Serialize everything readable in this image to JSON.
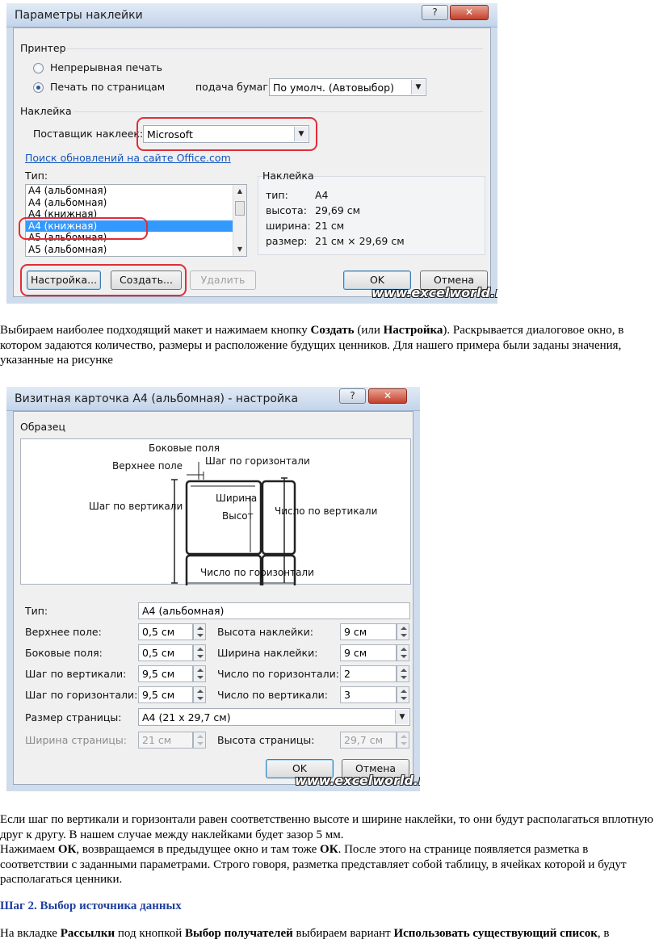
{
  "dialog1": {
    "title": "Параметры наклейки",
    "help_btn": "?",
    "close_btn": "✕",
    "printer_group": "Принтер",
    "radio_continuous": "Непрерывная печать",
    "radio_pages": "Печать по страницам",
    "paper_feed_label": "подача бумаги:",
    "paper_feed_value": "По умолч. (Автовыбор)",
    "label_group": "Наклейка",
    "vendor_label": "Поставщик наклеек:",
    "vendor_value": "Microsoft",
    "update_link": "Поиск обновлений на сайте Office.com",
    "type_label": "Тип:",
    "type_items": [
      "A4 (альбомная)",
      "A4 (альбомная)",
      "A4 (книжная)",
      "A4 (книжная)",
      "A5 (альбомная)",
      "A5 (альбомная)"
    ],
    "selected_index": 3,
    "info_group": "Наклейка",
    "info_rows": [
      {
        "k": "тип:",
        "v": "A4"
      },
      {
        "k": "высота:",
        "v": "29,69 см"
      },
      {
        "k": "ширина:",
        "v": "21 см"
      },
      {
        "k": "размер:",
        "v": "21 см × 29,69 см"
      }
    ],
    "btn_settings": "Настройка...",
    "btn_create": "Создать...",
    "btn_delete": "Удалить",
    "btn_ok": "OK",
    "btn_cancel": "Отмена",
    "watermark": "www.excelworld.ru"
  },
  "para1": {
    "t1": "Выбираем наиболее подходящий макет и нажимаем кнопку ",
    "b1": "Создать",
    "t2": " (или ",
    "b2": "Настройка",
    "t3": "). Раскрывается диалоговое окно, в котором задаются количество, размеры и расположение будущих ценников. Для нашего примера были заданы значения, указанные на рисунке"
  },
  "dialog2": {
    "title": "Визитная карточка A4 (альбомная) - настройка",
    "help_btn": "?",
    "close_btn": "✕",
    "sample_group": "Образец",
    "diagram": {
      "side_margins": "Боковые поля",
      "top_margin": "Верхнее поле",
      "horizontal_pitch": "Шаг по горизонтали",
      "vertical_pitch": "Шаг по вертикали",
      "width": "Ширина",
      "height": "Высот",
      "number_down": "Число по вертикали",
      "number_across": "Число по горизонтали"
    },
    "type_label": "Тип:",
    "type_value": "A4 (альбомная)",
    "fields_left": [
      {
        "label": "Верхнее поле:",
        "value": "0,5 см"
      },
      {
        "label": "Боковые поля:",
        "value": "0,5 см"
      },
      {
        "label": "Шаг по вертикали:",
        "value": "9,5 см"
      },
      {
        "label": "Шаг по горизонтали:",
        "value": "9,5 см"
      }
    ],
    "fields_right": [
      {
        "label": "Высота наклейки:",
        "value": "9 см"
      },
      {
        "label": "Ширина наклейки:",
        "value": "9 см"
      },
      {
        "label": "Число по горизонтали:",
        "value": "2"
      },
      {
        "label": "Число по вертикали:",
        "value": "3"
      }
    ],
    "page_size_label": "Размер страницы:",
    "page_size_value": "A4 (21 x 29,7 см)",
    "page_width_label": "Ширина страницы:",
    "page_width_value": "21 см",
    "page_height_label": "Высота страницы:",
    "page_height_value": "29,7 см",
    "btn_ok": "OK",
    "btn_cancel": "Отмена",
    "watermark": "www.excelworld.ru"
  },
  "para2": {
    "line1": "Если шаг по вертикали и горизонтали равен соответственно высоте и ширине наклейки, то они будут располагаться вплотную друг к другу. В нашем случае между наклейками будет зазор 5 мм.",
    "t1": "Нажимаем ",
    "b1": "ОК",
    "t2": ", возвращаемся в предыдущее окно и там тоже ",
    "b2": "ОК",
    "t3": ". После этого на странице появляется разметка в соответствии с заданными параметрами. Строго говоря, разметка представляет собой таблицу, в ячейках которой и будут располагаться ценники."
  },
  "heading": "Шаг 2. Выбор источника данных",
  "para3": {
    "t1": "На вкладке ",
    "b1": "Рассылки",
    "t2": " под кнопкой ",
    "b2": "Выбор получателей",
    "t3": " выбираем вариант ",
    "b3": "Использовать существующий список",
    "t4": ", в"
  },
  "colors": {
    "accent_red": "#e02d3a",
    "link_blue": "#1155bb",
    "heading_blue": "#1f3f9f",
    "selection": "#3399ff"
  }
}
